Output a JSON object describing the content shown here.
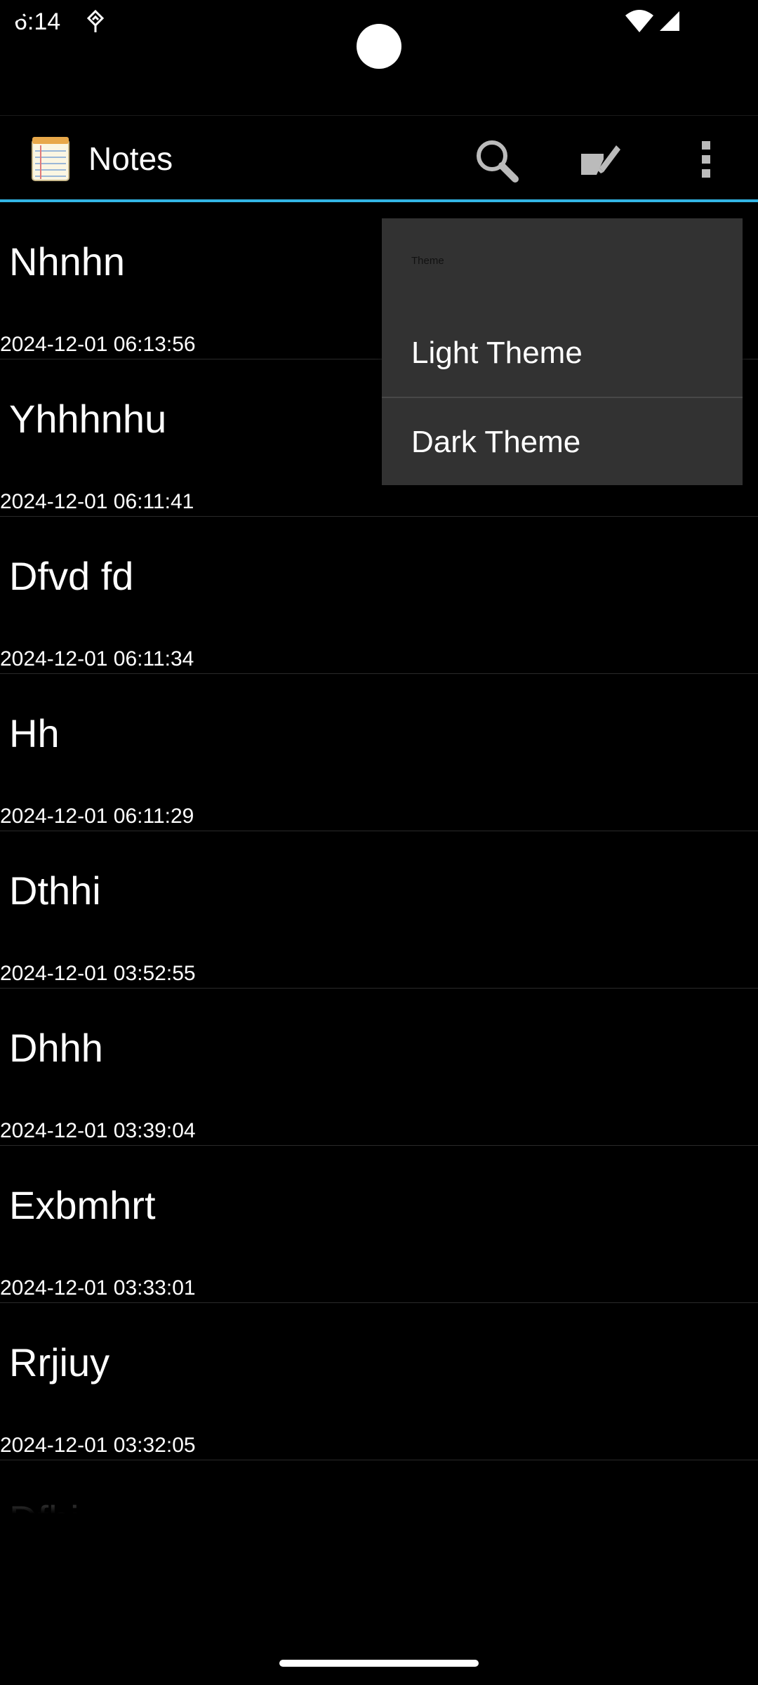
{
  "status_bar": {
    "time": "6:14"
  },
  "action_bar": {
    "title": "Notes",
    "icons": [
      "notepad-icon",
      "search-icon",
      "compose-icon",
      "more-vert-icon"
    ],
    "accent_color": "#33b5e5"
  },
  "notes": [
    {
      "title": "Nhnhn",
      "date": "2024-12-01 06:13:56"
    },
    {
      "title": "Yhhhnhu",
      "date": "2024-12-01 06:11:41"
    },
    {
      "title": "Dfvd fd",
      "date": "2024-12-01 06:11:34"
    },
    {
      "title": "Hh",
      "date": "2024-12-01 06:11:29"
    },
    {
      "title": "Dthhi",
      "date": "2024-12-01 03:52:55"
    },
    {
      "title": "Dhhh",
      "date": "2024-12-01 03:39:04"
    },
    {
      "title": "Exbmhrt",
      "date": "2024-12-01 03:33:01"
    },
    {
      "title": "Rrjiuy",
      "date": "2024-12-01 03:32:05"
    },
    {
      "title": "Dfhi",
      "date": ""
    }
  ],
  "menu": {
    "header": "Theme",
    "items": [
      {
        "label": "Light Theme"
      },
      {
        "label": "Dark Theme"
      }
    ]
  }
}
